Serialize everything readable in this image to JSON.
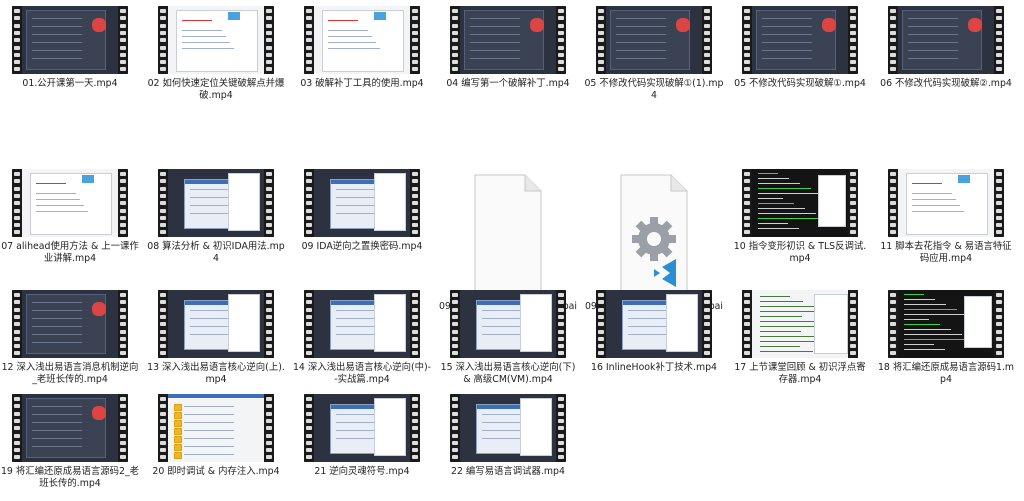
{
  "files": [
    {
      "name": "01.公开课第一天.mp4",
      "thumb": "dark-video"
    },
    {
      "name": "02 如何快速定位关键破解点并爆破.mp4",
      "thumb": "light-doc"
    },
    {
      "name": "03 破解补丁工具的使用.mp4",
      "thumb": "light-doc2"
    },
    {
      "name": "04 编写第一个破解补丁.mp4",
      "thumb": "dark-tool"
    },
    {
      "name": "05 不修改代码实现破解①(1).mp4",
      "thumb": "dark-tool"
    },
    {
      "name": "05 不修改代码实现破解①.mp4",
      "thumb": "dark-tool"
    },
    {
      "name": "06 不修改代码实现破解②.mp4",
      "thumb": "dark-tool"
    },
    {
      "name": "07 alihead使用方法 & 上一课作业讲解.mp4",
      "thumb": "light-doc"
    },
    {
      "name": "08 算法分析 & 初识IDA用法.mp4",
      "thumb": "dark-windows"
    },
    {
      "name": "09 IDA逆向之置换密码.mp4",
      "thumb": "dark-windows"
    },
    {
      "name": "09 IDA逆向之置换密码.mp4.baiduyun.downloading",
      "thumb": "blank-doc"
    },
    {
      "name": "09 IDA逆向之置换密码.mp4.baiduyun.downloading.cfg",
      "thumb": "cfg-doc"
    },
    {
      "name": "10 指令变形初识 & TLS反调试.mp4",
      "thumb": "dark-code"
    },
    {
      "name": "11 脚本去花指令 & 易语言特征码应用.mp4",
      "thumb": "light-doc"
    },
    {
      "name": "12 深入浅出易语言消息机制逆向_老班长传的.mp4",
      "thumb": "dark-tool"
    },
    {
      "name": "13 深入浅出易语言核心逆向(上).mp4",
      "thumb": "dark-windows"
    },
    {
      "name": "14 深入浅出易语言核心逆向(中)--实战篇.mp4",
      "thumb": "dark-windows"
    },
    {
      "name": "15 深入浅出易语言核心逆向(下) & 高级CM(VM).mp4",
      "thumb": "dark-windows"
    },
    {
      "name": "16 InlineHook补丁技术.mp4",
      "thumb": "dark-windows"
    },
    {
      "name": "17 上节课堂回顾 & 初识浮点寄存器.mp4",
      "thumb": "light-code"
    },
    {
      "name": "18 将汇编还原成易语言源码1.mp4",
      "thumb": "dark-code"
    },
    {
      "name": "19 将汇编还原成易语言源码2_老班长传的.mp4",
      "thumb": "dark-tool"
    },
    {
      "name": "20 即时调试 & 内存注入.mp4",
      "thumb": "light-list"
    },
    {
      "name": "21 逆向灵魂符号.mp4",
      "thumb": "dark-windows"
    },
    {
      "name": "22 编写易语言调试器.mp4",
      "thumb": "dark-windows"
    }
  ],
  "colors": {
    "accent": "#3d6fb6",
    "cfg_gear": "#9aa0a6",
    "vscode_blue": "#2b8fd6"
  },
  "icons": [
    "gear-icon",
    "vscode-icon"
  ]
}
